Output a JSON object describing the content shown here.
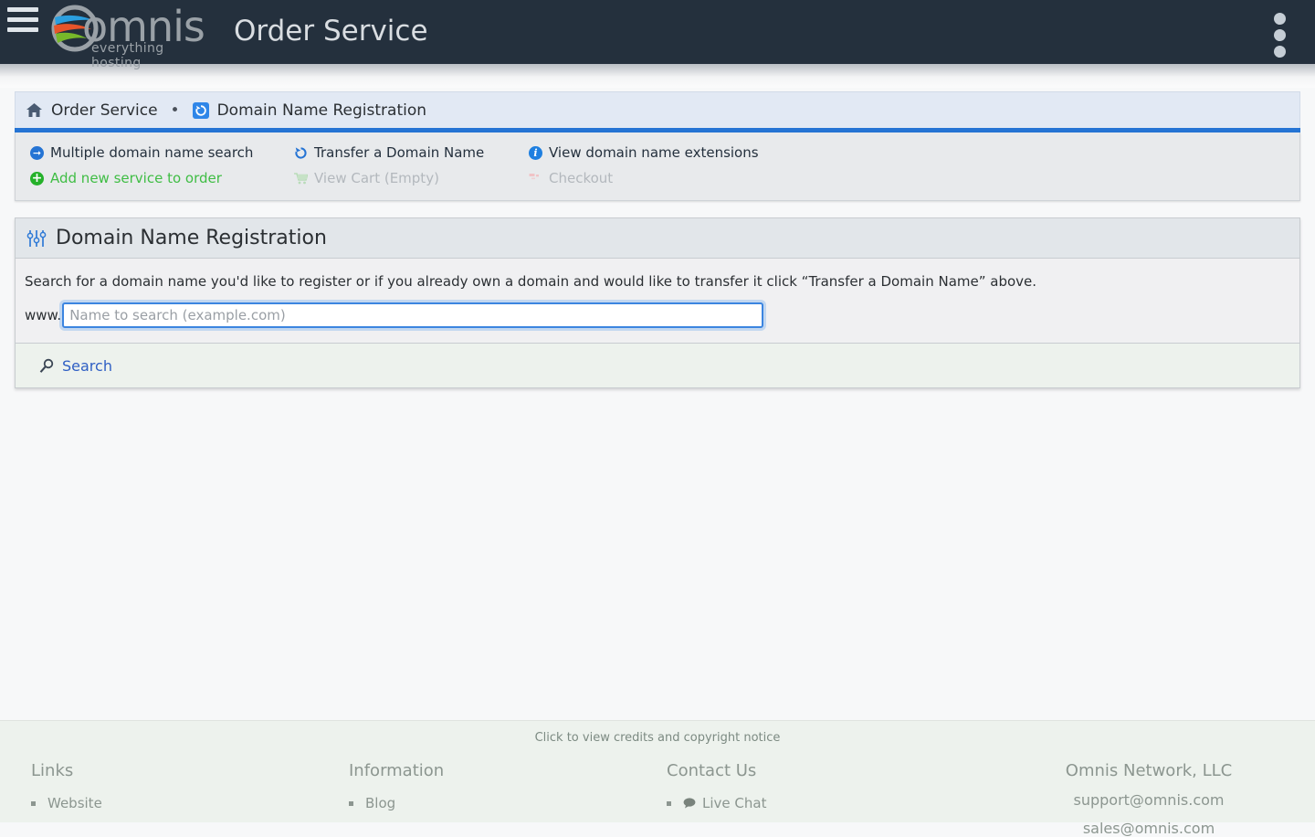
{
  "header": {
    "menu_icon": "hamburger-icon",
    "logo_word": "omnis",
    "logo_tagline": "everything hosting",
    "app_title": "Order Service",
    "overflow_icon": "kebab-menu-icon"
  },
  "breadcrumb": {
    "home_icon": "home-icon",
    "root_label": "Order Service",
    "separator": "•",
    "page_icon": "refresh-circle-icon",
    "current_label": "Domain Name Registration"
  },
  "toolbar": {
    "items": [
      {
        "label": "Multiple domain name search",
        "icon": "arrow-right-circle-icon",
        "state": "enabled"
      },
      {
        "label": "Transfer a Domain Name",
        "icon": "refresh-icon",
        "state": "enabled"
      },
      {
        "label": "View domain name extensions",
        "icon": "info-circle-icon",
        "state": "enabled"
      },
      {
        "label": "Add new service to order",
        "icon": "plus-circle-icon",
        "state": "enabled-green"
      },
      {
        "label": "View Cart (Empty)",
        "icon": "shopping-cart-icon",
        "state": "disabled"
      },
      {
        "label": "Checkout",
        "icon": "credit-card-icon",
        "state": "disabled"
      }
    ]
  },
  "panel": {
    "icon": "sliders-icon",
    "title": "Domain Name Registration",
    "description": "Search for a domain name you'd like to register or if you already own a domain and would like to transfer it click “Transfer a Domain Name” above.",
    "prefix_label": "www.",
    "input_value": "",
    "input_placeholder": "Name to search (example.com)",
    "search_icon": "magnifier-icon",
    "search_label": "Search"
  },
  "footer": {
    "credits": "Click to view credits and copyright notice",
    "columns": [
      {
        "heading": "Links",
        "items": [
          {
            "label": "Website",
            "icon": "square-bullet"
          }
        ]
      },
      {
        "heading": "Information",
        "items": [
          {
            "label": "Blog",
            "icon": "square-bullet"
          }
        ]
      },
      {
        "heading": "Contact Us",
        "items": [
          {
            "label": "Live Chat",
            "icon": "chat-bubble-icon"
          }
        ]
      }
    ],
    "company": {
      "heading": "Omnis Network, LLC",
      "email": "support@omnis.com",
      "phone": "sales@omnis.com"
    }
  },
  "colors": {
    "header_bg": "#24303d",
    "accent_blue": "#2574d4",
    "accent_green": "#3fbd44",
    "breadcrumb_bg": "#e2e9f4",
    "panel_bg": "#f0f0f2",
    "footer_bg": "#edf2ed",
    "focus_border": "#3c85e0"
  }
}
